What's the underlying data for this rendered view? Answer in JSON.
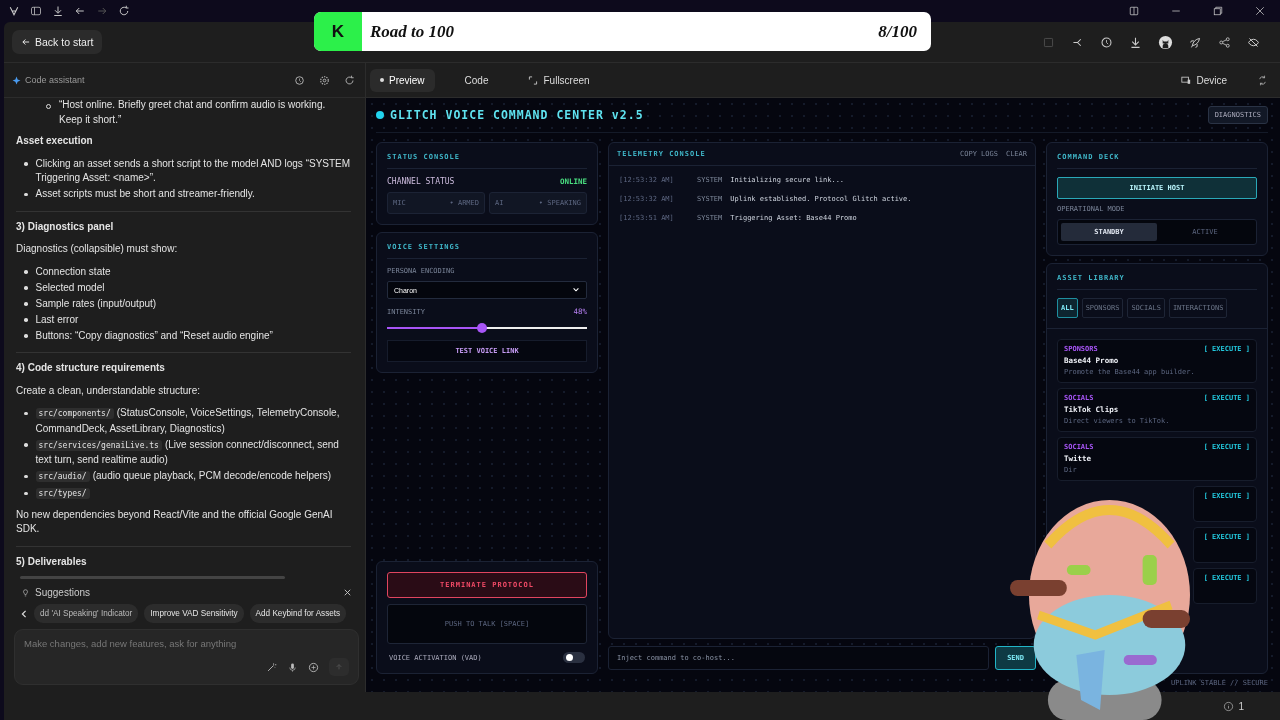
{
  "overlay": {
    "badge": "K",
    "title": "Road to 100",
    "count": "8/100"
  },
  "header": {
    "back_button": "Back to start"
  },
  "assistant": {
    "title": "Code assistant",
    "blocks": [
      {
        "kind": "sublist",
        "items": [
          {
            "text": "“Host online. Briefly greet chat and confirm audio is working. Keep it short.”"
          }
        ]
      },
      {
        "kind": "heading",
        "text": "Asset execution"
      },
      {
        "kind": "list",
        "items": [
          {
            "text": "Clicking an asset sends a short script to the model AND logs “SYSTEM Triggering Asset: <name>”."
          },
          {
            "text": "Asset scripts must be short and streamer-friendly."
          }
        ]
      },
      {
        "kind": "rule"
      },
      {
        "kind": "heading",
        "text": "3) Diagnostics panel"
      },
      {
        "kind": "para",
        "text": "Diagnostics (collapsible) must show:"
      },
      {
        "kind": "list",
        "items": [
          {
            "text": "Connection state"
          },
          {
            "text": "Selected model"
          },
          {
            "text": "Sample rates (input/output)"
          },
          {
            "text": "Last error"
          },
          {
            "text": "Buttons: “Copy diagnostics” and “Reset audio engine”"
          }
        ]
      },
      {
        "kind": "rule"
      },
      {
        "kind": "heading",
        "text": "4) Code structure requirements"
      },
      {
        "kind": "para",
        "text": "Create a clean, understandable structure:"
      },
      {
        "kind": "list",
        "items": [
          {
            "code": "src/components/",
            "text": "(StatusConsole, VoiceSettings, TelemetryConsole, CommandDeck, AssetLibrary, Diagnostics)"
          },
          {
            "code": "src/services/genaiLive.ts",
            "text": "(Live session connect/disconnect, send text turn, send realtime audio)"
          },
          {
            "code": "src/audio/",
            "text": "(audio queue playback, PCM decode/encode helpers)"
          },
          {
            "code": "src/types/"
          }
        ]
      },
      {
        "kind": "para",
        "text": "No new dependencies beyond React/Vite and the official Google GenAI SDK."
      },
      {
        "kind": "rule"
      },
      {
        "kind": "heading",
        "text": "5) Deliverables"
      }
    ],
    "suggestions": {
      "title": "Suggestions",
      "chips": [
        "dd 'AI Speaking' Indicator",
        "Improve VAD Sensitivity",
        "Add Keybind for Assets"
      ]
    },
    "composer": {
      "placeholder": "Make changes, add new features, ask for anything"
    }
  },
  "preview_tabs": [
    {
      "label": "Preview",
      "selected": true
    },
    {
      "label": "Code",
      "selected": false
    },
    {
      "label": "Fullscreen",
      "selected": false
    }
  ],
  "device_button": "Device",
  "app": {
    "title": "GLITCH VOICE COMMAND CENTER v2.5",
    "diagnostics_button": "DIAGNOSTICS",
    "status_console": {
      "title": "STATUS CONSOLE",
      "label": "CHANNEL STATUS",
      "status": "ONLINE",
      "indicators": [
        {
          "name": "MIC",
          "state": "• ARMED",
          "active": false
        },
        {
          "name": "AI",
          "state": "• SPEAKING",
          "active": false
        }
      ]
    },
    "voice_settings": {
      "title": "VOICE SETTINGS",
      "persona_label": "PERSONA ENCODING",
      "persona": "Charon",
      "intensity_label": "INTENSITY",
      "intensity_reading": "48%",
      "level": 0.48,
      "test_button": "TEST VOICE LINK"
    },
    "controls": {
      "terminate_button": "TERMINATE PROTOCOL",
      "push_button": "PUSH TO TALK [SPACE]",
      "vad_label": "VOICE ACTIVATION (VAD)",
      "vad_on": false
    },
    "telemetry": {
      "title": "TELEMETRY CONSOLE",
      "actions": [
        "COPY LOGS",
        "CLEAR"
      ],
      "logs": [
        {
          "time": "[12:53:32 AM]",
          "source": "SYSTEM",
          "message": "Initializing secure link..."
        },
        {
          "time": "[12:53:32 AM]",
          "source": "SYSTEM",
          "message": "Uplink established. Protocol Glitch active."
        },
        {
          "time": "[12:53:51 AM]",
          "source": "SYSTEM",
          "message": "Triggering Asset: Base44 Promo"
        }
      ],
      "input_placeholder": "Inject command to co-host...",
      "send_button": "SEND"
    },
    "command_deck": {
      "title": "COMMAND DECK",
      "initiate_button": "INITIATE HOST",
      "mode_label": "OPERATIONAL MODE",
      "modes": [
        {
          "label": "STANDBY",
          "selected": true
        },
        {
          "label": "ACTIVE",
          "selected": false
        }
      ]
    },
    "asset_library": {
      "title": "ASSET LIBRARY",
      "filters": [
        {
          "label": "ALL",
          "selected": true
        },
        {
          "label": "SPONSORS",
          "selected": false
        },
        {
          "label": "SOCIALS",
          "selected": false
        },
        {
          "label": "INTERACTIONS",
          "selected": false
        }
      ],
      "assets": [
        {
          "tag": "SPONSORS",
          "name": "Base44 Promo",
          "description": "Promote the Base44 app builder.",
          "action": "[ EXECUTE ]"
        },
        {
          "tag": "SOCIALS",
          "name": "TikTok Clips",
          "description": "Direct viewers to TikTok.",
          "action": "[ EXECUTE ]"
        },
        {
          "tag": "SOCIALS",
          "name": "Twitte",
          "description": "Dir",
          "action": "[ EXECUTE ]"
        },
        {
          "action": "[ EXECUTE ]"
        },
        {
          "action": "[ EXECUTE ]"
        },
        {
          "action": "[ EXECUTE ]"
        }
      ]
    },
    "footer": "UPLINK STABLE // SECURE"
  },
  "status_count": "1"
}
